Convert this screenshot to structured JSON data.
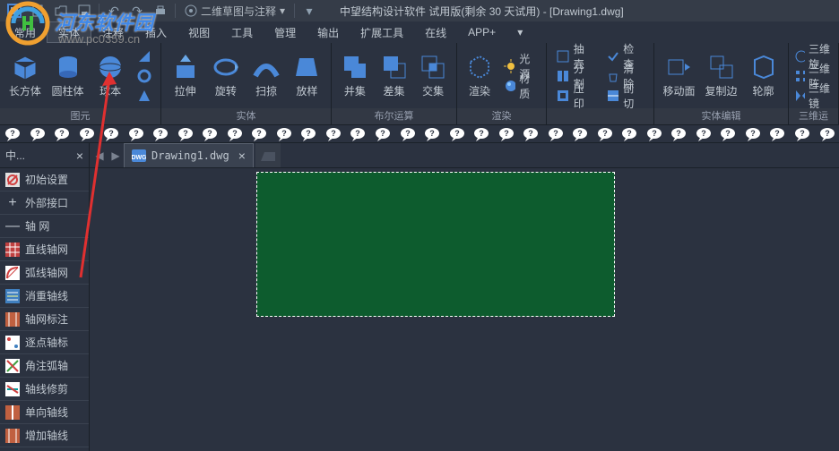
{
  "title": {
    "dropdown": "二维草图与注释",
    "text": "中望结构设计软件 试用版(剩余 30 天试用) - [Drawing1.dwg]"
  },
  "menu": {
    "items": [
      "常用",
      "实体",
      "注释",
      "插入",
      "视图",
      "工具",
      "管理",
      "输出",
      "扩展工具",
      "在线",
      "APP+"
    ],
    "active_index": 1
  },
  "ribbon": {
    "groups": [
      {
        "label": "图元",
        "large": [
          {
            "name": "box",
            "label": "长方体"
          },
          {
            "name": "cylinder",
            "label": "圆柱体"
          },
          {
            "name": "sphere",
            "label": "球本"
          }
        ]
      },
      {
        "label": "实体",
        "large": [
          {
            "name": "extrude",
            "label": "拉伸"
          },
          {
            "name": "revolve",
            "label": "旋转"
          },
          {
            "name": "sweep",
            "label": "扫掠"
          },
          {
            "name": "loft",
            "label": "放样"
          }
        ]
      },
      {
        "label": "布尔运算",
        "large": [
          {
            "name": "union",
            "label": "并集"
          },
          {
            "name": "subtract",
            "label": "差集"
          },
          {
            "name": "intersect",
            "label": "交集"
          }
        ]
      },
      {
        "label": "渲染",
        "large": [
          {
            "name": "render",
            "label": "渲染"
          }
        ],
        "small": [
          {
            "name": "light",
            "label": "光源"
          },
          {
            "name": "material",
            "label": "材质"
          }
        ]
      },
      {
        "label": "",
        "small_cols": [
          [
            {
              "name": "shell",
              "label": "抽壳"
            },
            {
              "name": "split",
              "label": "分割"
            },
            {
              "name": "imprint",
              "label": "压印"
            }
          ],
          [
            {
              "name": "check",
              "label": "检查"
            },
            {
              "name": "clean",
              "label": "清除"
            },
            {
              "name": "slice",
              "label": "剖切"
            }
          ]
        ]
      },
      {
        "label": "实体编辑",
        "large": [
          {
            "name": "moveface",
            "label": "移动面"
          },
          {
            "name": "copyedge",
            "label": "复制边"
          },
          {
            "name": "silhouette",
            "label": "轮廓"
          }
        ]
      },
      {
        "label": "三维运",
        "small": [
          {
            "name": "3drotate",
            "label": "三维旋"
          },
          {
            "name": "3darray",
            "label": "三维阵"
          },
          {
            "name": "3dmirror",
            "label": "三维镜"
          }
        ]
      }
    ]
  },
  "side": {
    "tab_label": "中...",
    "items": [
      {
        "name": "init",
        "label": "初始设置"
      },
      {
        "name": "external",
        "label": "外部接口"
      },
      {
        "name": "axis-grid",
        "label": "轴    网"
      },
      {
        "name": "line-grid",
        "label": "直线轴网"
      },
      {
        "name": "arc-grid",
        "label": "弧线轴网"
      },
      {
        "name": "dedup",
        "label": "消重轴线"
      },
      {
        "name": "grid-label",
        "label": "轴网标注"
      },
      {
        "name": "point-label",
        "label": "逐点轴标"
      },
      {
        "name": "angle-arc",
        "label": "角注弧轴"
      },
      {
        "name": "trim-axis",
        "label": "轴线修剪"
      },
      {
        "name": "single-axis",
        "label": "单向轴线"
      },
      {
        "name": "add-axis",
        "label": "增加轴线"
      }
    ]
  },
  "file_tab": {
    "name": "Drawing1.dwg"
  },
  "logo": {
    "text": "河东软件园",
    "url": "www.pc0359.cn"
  }
}
